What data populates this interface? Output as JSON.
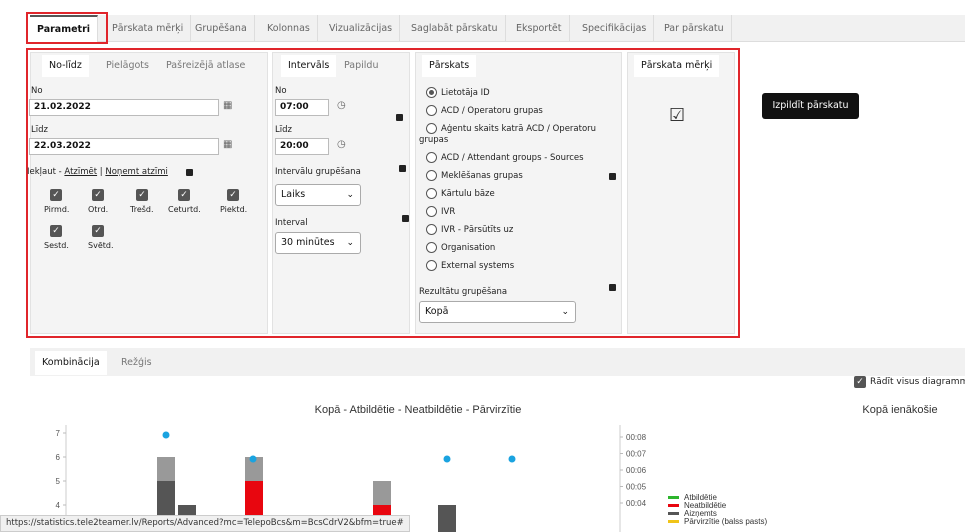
{
  "top_tabs": [
    "Parametri",
    "Pārskata mērķi",
    "Grupēšana",
    "Kolonnas",
    "Vizualizācijas",
    "Saglabāt pārskatu",
    "Eksportēt",
    "Specifikācijas",
    "Par pārskatu"
  ],
  "date_panel": {
    "tabs": [
      "No-līdz",
      "Pielāgots",
      "Pašreizējā atlase"
    ],
    "from_label": "No",
    "from_value": "21.02.2022",
    "to_label": "Līdz",
    "to_value": "22.03.2022",
    "include_prefix": "Iekļaut -",
    "mark_all": "Atzīmēt",
    "separator": "|",
    "unmark_all": "Noņemt atzīmi",
    "days": [
      "Pirmd.",
      "Otrd.",
      "Trešd.",
      "Ceturtd.",
      "Piektd.",
      "Sestd.",
      "Svētd."
    ]
  },
  "interval_panel": {
    "tabs": [
      "Intervāls",
      "Papildu"
    ],
    "from_label": "No",
    "from_value": "07:00",
    "to_label": "Līdz",
    "to_value": "20:00",
    "grouping_label": "Intervālu grupēšana",
    "grouping_value": "Laiks",
    "interval_label": "Interval",
    "interval_value": "30 minūtes"
  },
  "report_panel": {
    "tab": "Pārskats",
    "options": [
      "Lietotāja ID",
      "ACD / Operatoru grupas",
      "Aģentu skaits katrā ACD / Operatoru",
      "grupas",
      "ACD / Attendant groups - Sources",
      "Meklēšanas grupas",
      "Kārtulu bāze",
      "IVR",
      "IVR - Pārsūtīts uz",
      "Organisation",
      "External systems"
    ],
    "selected": "Lietotāja ID",
    "grouping_label": "Rezultātu grupēšana",
    "grouping_value": "Kopā"
  },
  "target_panel": {
    "tab": "Pārskata mērķi"
  },
  "run_button": "Izpildīt pārskatu",
  "bottom_tabs": [
    "Kombinācija",
    "Režģis"
  ],
  "show_all_label": "Rādīt visus diagramma",
  "status_url": "https://statistics.tele2teamer.lv/Reports/Advanced?mc=TelepoBcs&m=BcsCdrV2&bfm=true#",
  "chart_data": [
    {
      "type": "bar",
      "title": "Kopā - Atbildētie - Neatbildētie - Pārvirzītie",
      "yticks": [
        "7",
        "6",
        "5",
        "4"
      ],
      "y2ticks": [
        "00:08",
        "00:07",
        "00:06",
        "00:05",
        "00:04"
      ],
      "legend": [
        "Atbildētie",
        "Neatbildētie",
        "Aizņemts",
        "Pārvirzītie (balss pasts)"
      ],
      "colors": {
        "answered": "#2db52d",
        "unanswered": "#e8060f",
        "busy": "#555555",
        "redirected": "#f0c419",
        "total": "#999999",
        "dots": "#1aa3e0"
      },
      "bars": [
        {
          "x": "1",
          "unanswered": 0,
          "busy": 5,
          "total": 6
        },
        {
          "x": "2",
          "unanswered": 0,
          "busy": 4,
          "total": 4
        },
        {
          "x": "3",
          "unanswered": 5,
          "busy": 0,
          "total": 6
        },
        {
          "x": "4",
          "unanswered": 4,
          "busy": 0,
          "total": 5
        },
        {
          "x": "5",
          "unanswered": 0,
          "busy": 4,
          "total": 4
        }
      ],
      "dots": [
        7,
        6,
        6,
        6
      ]
    },
    {
      "title": "Kopā ienākošie"
    }
  ]
}
